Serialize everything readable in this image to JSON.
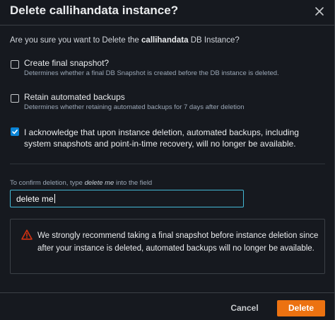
{
  "modal": {
    "title": "Delete callihandata instance?",
    "question_prefix": "Are you sure you want to Delete the ",
    "instance_name": "callihandata",
    "question_suffix": " DB Instance?"
  },
  "options": [
    {
      "label": "Create final snapshot?",
      "description": "Determines whether a final DB Snapshot is created before the DB instance is deleted.",
      "checked": false
    },
    {
      "label": "Retain automated backups",
      "description": "Determines whether retaining automated backups for 7 days after deletion",
      "checked": false
    }
  ],
  "acknowledge": {
    "text": "I acknowledge that upon instance deletion, automated backups, including system snapshots and point-in-time recovery, will no longer be available.",
    "checked": true
  },
  "confirm": {
    "label_prefix": "To confirm deletion, type ",
    "label_phrase": "delete me",
    "label_suffix": " into the field",
    "value": "delete me"
  },
  "alert": {
    "icon": "warning-icon",
    "text": "We strongly recommend taking a final snapshot before instance deletion since after your instance is deleted, automated backups will no longer be available."
  },
  "footer": {
    "cancel_label": "Cancel",
    "delete_label": "Delete"
  },
  "colors": {
    "background": "#16191f",
    "primary": "#ec7211",
    "checkbox_checked": "#0a84d6",
    "input_focus": "#44b9d6",
    "warning": "#d13212"
  }
}
